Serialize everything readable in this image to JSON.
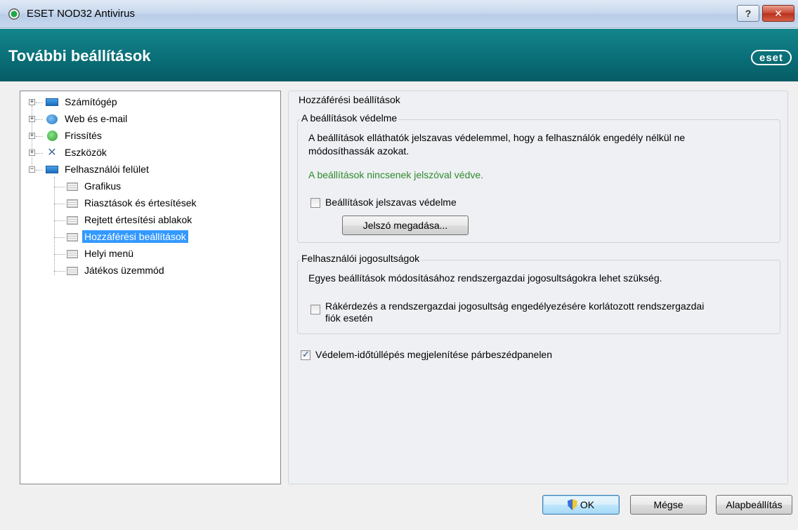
{
  "window": {
    "title": "ESET NOD32 Antivirus",
    "help_label": "?",
    "close_label": "✕"
  },
  "header": {
    "title": "További beállítások",
    "logo": "eset"
  },
  "tree": {
    "items": [
      {
        "label": "Számítógép"
      },
      {
        "label": "Web és e-mail"
      },
      {
        "label": "Frissítés"
      },
      {
        "label": "Eszközök"
      },
      {
        "label": "Felhasználói felület"
      },
      {
        "label": "Grafikus"
      },
      {
        "label": "Riasztások és értesítések"
      },
      {
        "label": "Rejtett értesítési ablakok"
      },
      {
        "label": "Hozzáférési beállítások",
        "selected": true
      },
      {
        "label": "Helyi menü"
      },
      {
        "label": "Játékos üzemmód"
      }
    ],
    "icons": [
      "computer-icon",
      "web-icon",
      "update-icon",
      "tools-icon",
      "monitor-icon",
      "page-icon"
    ]
  },
  "main": {
    "section_title": "Hozzáférési beállítások",
    "protection": {
      "title": "A beállítások védelme",
      "description_line1": "A beállítások elláthatók jelszavas védelemmel, hogy a felhasználók engedély nélkül ne",
      "description_line2": "módosíthassák azokat.",
      "status": "A beállítások nincsenek jelszóval védve.",
      "checkbox_label": "Beállítások jelszavas védelme",
      "checkbox_checked": false,
      "set_password_button": "Jelszó megadása..."
    },
    "rights": {
      "title": "Felhasználói jogosultságok",
      "description": "Egyes beállítások módosításához rendszergazdai jogosultságokra lehet szükség.",
      "checkbox_label_line1": "Rákérdezés a rendszergazdai jogosultság engedélyezésére korlátozott rendszergazdai",
      "checkbox_label_line2": "fiók esetén",
      "checkbox_checked": false
    },
    "timeout_checkbox_label": "Védelem-időtúllépés megjelenítése párbeszédpanelen",
    "timeout_checkbox_checked": true
  },
  "footer": {
    "ok_label": "OK",
    "cancel_label": "Mégse",
    "defaults_label": "Alapbeállítás"
  },
  "colors": {
    "header_bg": "#0a6f78",
    "status_green": "#2e8b2e",
    "selection": "#3399ff"
  }
}
